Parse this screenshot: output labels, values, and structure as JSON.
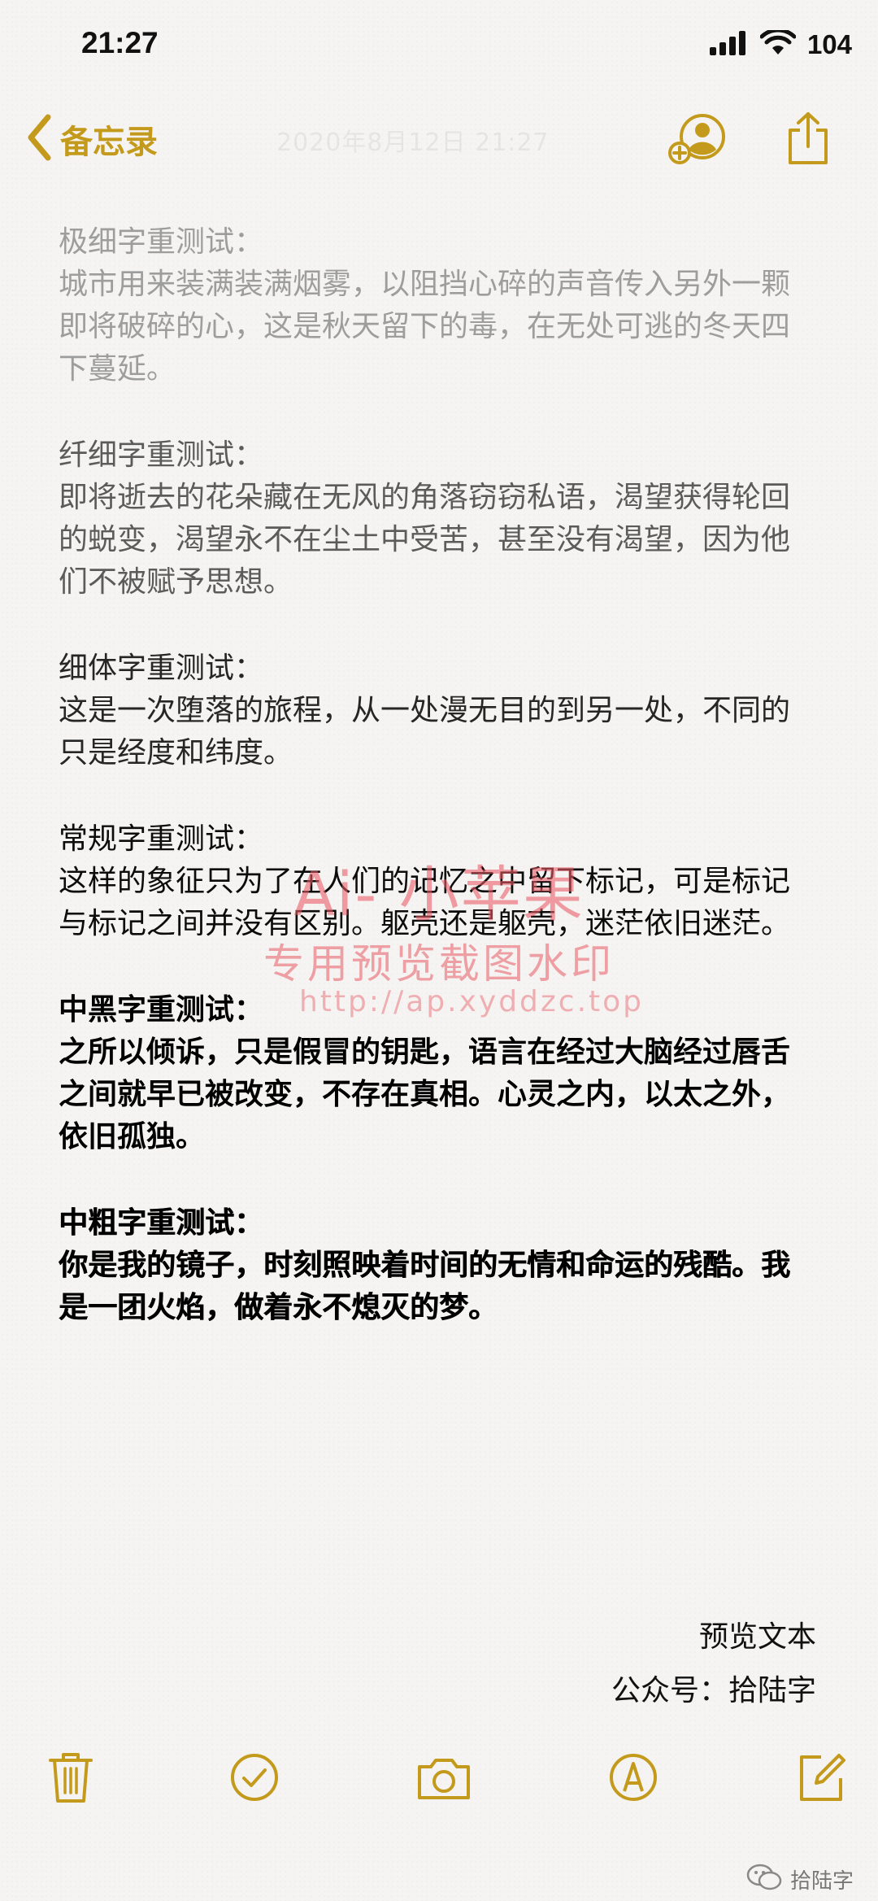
{
  "status": {
    "time": "21:27",
    "battery": "104"
  },
  "nav": {
    "back_label": "备忘录",
    "faint_date": "2020年8月12日 21:27"
  },
  "note": {
    "sections": [
      {
        "title": "极细字重测试：",
        "body": "城市用来装满装满烟雾，以阻挡心碎的声音传入另外一颗即将破碎的心，这是秋天留下的毒，在无处可逃的冬天四下蔓延。"
      },
      {
        "title": "纤细字重测试：",
        "body": "即将逝去的花朵藏在无风的角落窃窃私语，渴望获得轮回的蜕变，渴望永不在尘土中受苦，甚至没有渴望，因为他们不被赋予思想。"
      },
      {
        "title": "细体字重测试：",
        "body": "这是一次堕落的旅程，从一处漫无目的到另一处，不同的只是经度和纬度。"
      },
      {
        "title": "常规字重测试：",
        "body": "这样的象征只为了在人们的记忆之中留下标记，可是标记与标记之间并没有区别。躯壳还是躯壳，迷茫依旧迷茫。"
      },
      {
        "title": "中黑字重测试：",
        "body": "之所以倾诉，只是假冒的钥匙，语言在经过大脑经过唇舌之间就早已被改变，不存在真相。心灵之内，以太之外，依旧孤独。"
      },
      {
        "title": "中粗字重测试：",
        "body": "你是我的镜子，时刻照映着时间的无情和命运的残酷。我是一团火焰，做着永不熄灭的梦。"
      }
    ],
    "signature_line1": "预览文本",
    "signature_line2": "公众号：拾陆字"
  },
  "watermark": {
    "line1": "Ai- 小苹果",
    "line2": "专用预览截图水印",
    "line3": "http://ap.xyddzc.top"
  },
  "corner_mark": "拾陆字",
  "colors": {
    "accent": "#c49a1c",
    "watermark": "#e85a64"
  },
  "icons": {
    "back": "chevron-left-icon",
    "collab": "person-add-icon",
    "share": "share-icon",
    "trash": "trash-icon",
    "checklist": "checkmark-circle-icon",
    "camera": "camera-icon",
    "markup": "pen-circle-icon",
    "compose": "compose-icon"
  }
}
